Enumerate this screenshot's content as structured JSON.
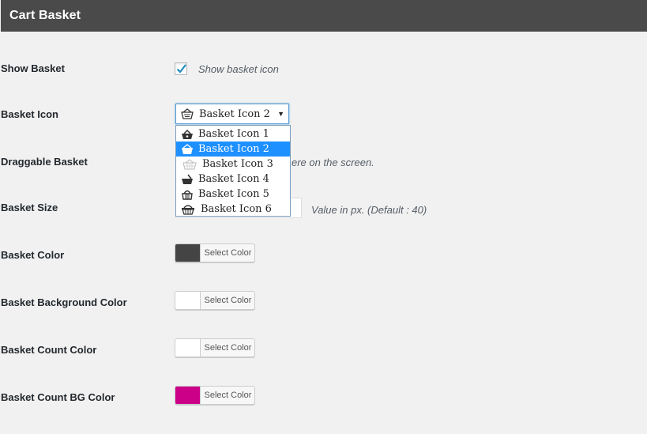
{
  "header": {
    "title": "Cart Basket"
  },
  "show_basket": {
    "label": "Show Basket",
    "checked": true,
    "help": "Show basket icon"
  },
  "basket_icon": {
    "label": "Basket Icon",
    "selected": "Basket Icon 2",
    "options": [
      "Basket Icon 1",
      "Basket Icon 2",
      "Basket Icon 3",
      "Basket Icon 4",
      "Basket Icon 5",
      "Basket Icon 6"
    ],
    "highlighted_index": 1
  },
  "draggable_basket": {
    "label": "Draggable Basket",
    "help_visible": "ere on the screen."
  },
  "basket_size": {
    "label": "Basket Size",
    "help": "Value in px. (Default : 40)"
  },
  "colors": [
    {
      "label": "Basket Color",
      "button": "Select Color",
      "value": "#444444"
    },
    {
      "label": "Basket Background Color",
      "button": "Select Color",
      "value": "#ffffff"
    },
    {
      "label": "Basket Count Color",
      "button": "Select Color",
      "value": "#ffffff"
    },
    {
      "label": "Basket Count BG Color",
      "button": "Select Color",
      "value": "#cc0088"
    }
  ],
  "accent": "#1e90ff"
}
